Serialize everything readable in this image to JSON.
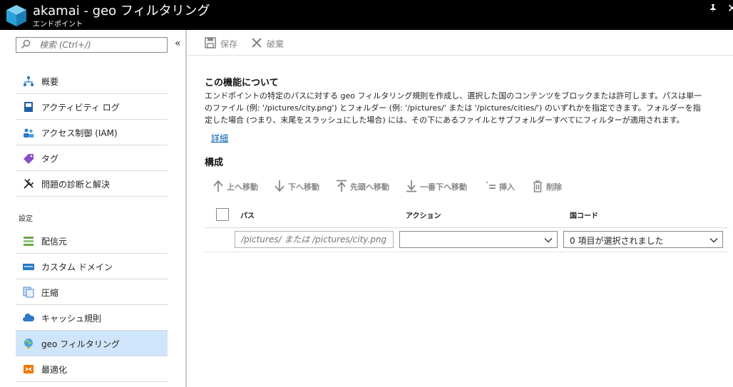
{
  "titlebar": {
    "title": "akamai - geo フィルタリング",
    "subtitle": "エンドポイント"
  },
  "sidebar": {
    "search_placeholder": "検索 (Ctrl+/)",
    "items": [
      {
        "label": "概要",
        "icon": "network-icon"
      },
      {
        "label": "アクティビティ ログ",
        "icon": "log-icon"
      },
      {
        "label": "アクセス制御 (IAM)",
        "icon": "people-icon"
      },
      {
        "label": "タグ",
        "icon": "tag-icon"
      },
      {
        "label": "問題の診断と解決",
        "icon": "wrench-icon"
      }
    ],
    "section_label": "設定",
    "settings_items": [
      {
        "label": "配信元",
        "icon": "origin-icon"
      },
      {
        "label": "カスタム ドメイン",
        "icon": "domain-icon"
      },
      {
        "label": "圧縮",
        "icon": "compress-icon"
      },
      {
        "label": "キャッシュ規則",
        "icon": "cloud-icon"
      },
      {
        "label": "geo フィルタリング",
        "icon": "globe-icon",
        "active": true
      },
      {
        "label": "最適化",
        "icon": "optimize-icon"
      }
    ]
  },
  "toolbar": {
    "save_label": "保存",
    "discard_label": "破棄"
  },
  "about": {
    "title": "この機能について",
    "description": "エンドポイントの特定のパスに対する geo フィルタリング規則を作成し、選択した国のコンテンツをブロックまたは許可します。パスは単一のファイル (例: '/pictures/city.png') とフォルダー (例: '/pictures/' または '/pictures/cities/') のいずれかを指定できます。フォルダーを指定した場合 (つまり、末尾をスラッシュにした場合) には、その下にあるファイルとサブフォルダーすべてにフィルターが適用されます。",
    "link": "詳細"
  },
  "config": {
    "title": "構成",
    "actions": {
      "move_up": "上へ移動",
      "move_down": "下へ移動",
      "move_top": "先頭へ移動",
      "move_bottom": "一番下へ移動",
      "insert": "挿入",
      "delete": "削除"
    },
    "columns": {
      "path": "パス",
      "action": "アクション",
      "country": "国コード"
    },
    "row": {
      "path_placeholder": "/pictures/ または /pictures/city.png",
      "action_value": "",
      "country_value": "0 項目が選択されました"
    }
  },
  "colors": {
    "titlebar_bg": "#000000",
    "active_nav_bg": "#cfe5fb",
    "link": "#0060b0"
  }
}
